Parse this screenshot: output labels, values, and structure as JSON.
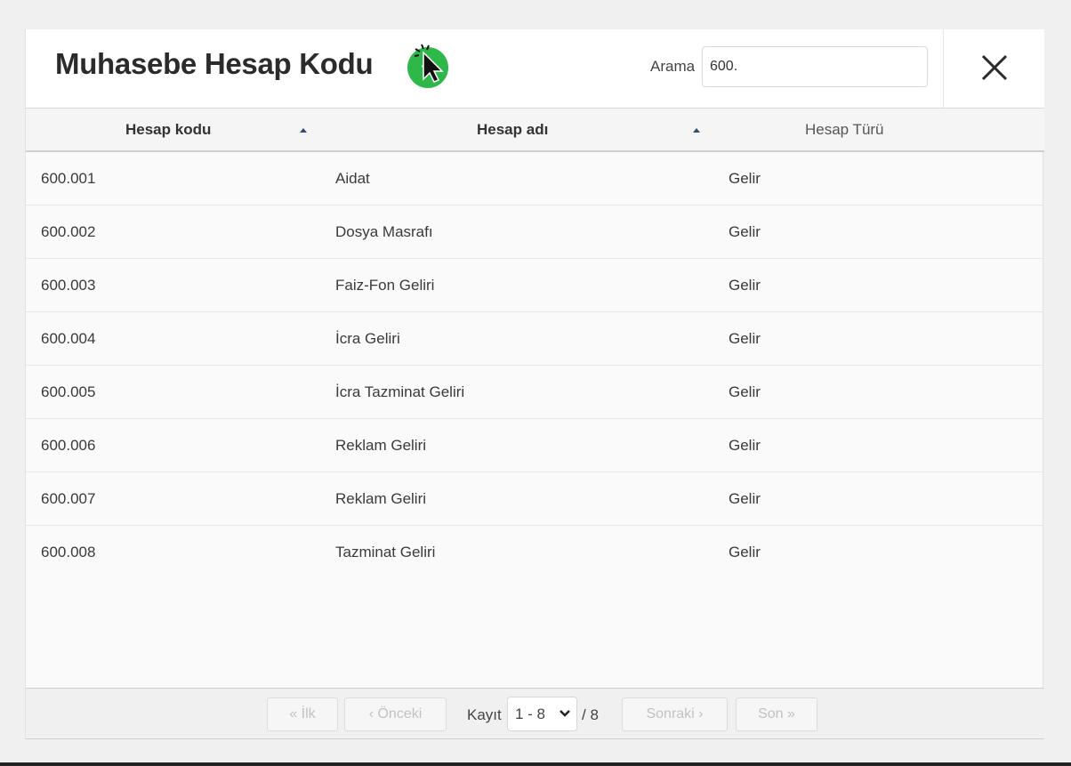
{
  "modal": {
    "title": "Muhasebe Hesap Kodu",
    "add_icon": "plus-icon",
    "close_icon": "close-icon",
    "search": {
      "label": "Arama",
      "value": "600."
    }
  },
  "table": {
    "columns": [
      {
        "label": "Hesap kodu",
        "sorted": "asc"
      },
      {
        "label": "Hesap adı",
        "sorted": "asc"
      },
      {
        "label": "Hesap Türü"
      }
    ],
    "rows": [
      {
        "code": "600.001",
        "name": "Aidat",
        "type": "Gelir"
      },
      {
        "code": "600.002",
        "name": "Dosya Masrafı",
        "type": "Gelir"
      },
      {
        "code": "600.003",
        "name": "Faiz-Fon Geliri",
        "type": "Gelir"
      },
      {
        "code": "600.004",
        "name": "İcra Geliri",
        "type": "Gelir"
      },
      {
        "code": "600.005",
        "name": "İcra Tazminat Geliri",
        "type": "Gelir"
      },
      {
        "code": "600.006",
        "name": "Reklam Geliri",
        "type": "Gelir"
      },
      {
        "code": "600.007",
        "name": "Reklam Geliri",
        "type": "Gelir"
      },
      {
        "code": "600.008",
        "name": "Tazminat Geliri",
        "type": "Gelir"
      }
    ]
  },
  "pagination": {
    "first": "« İlk",
    "prev": "‹ Önceki",
    "record_label": "Kayıt",
    "range": "1 - 8",
    "total": "/ 8",
    "next": "Sonraki ›",
    "last": "Son »"
  },
  "colors": {
    "accent_green": "#2fb84a",
    "sort_arrow": "#2d4f75"
  }
}
